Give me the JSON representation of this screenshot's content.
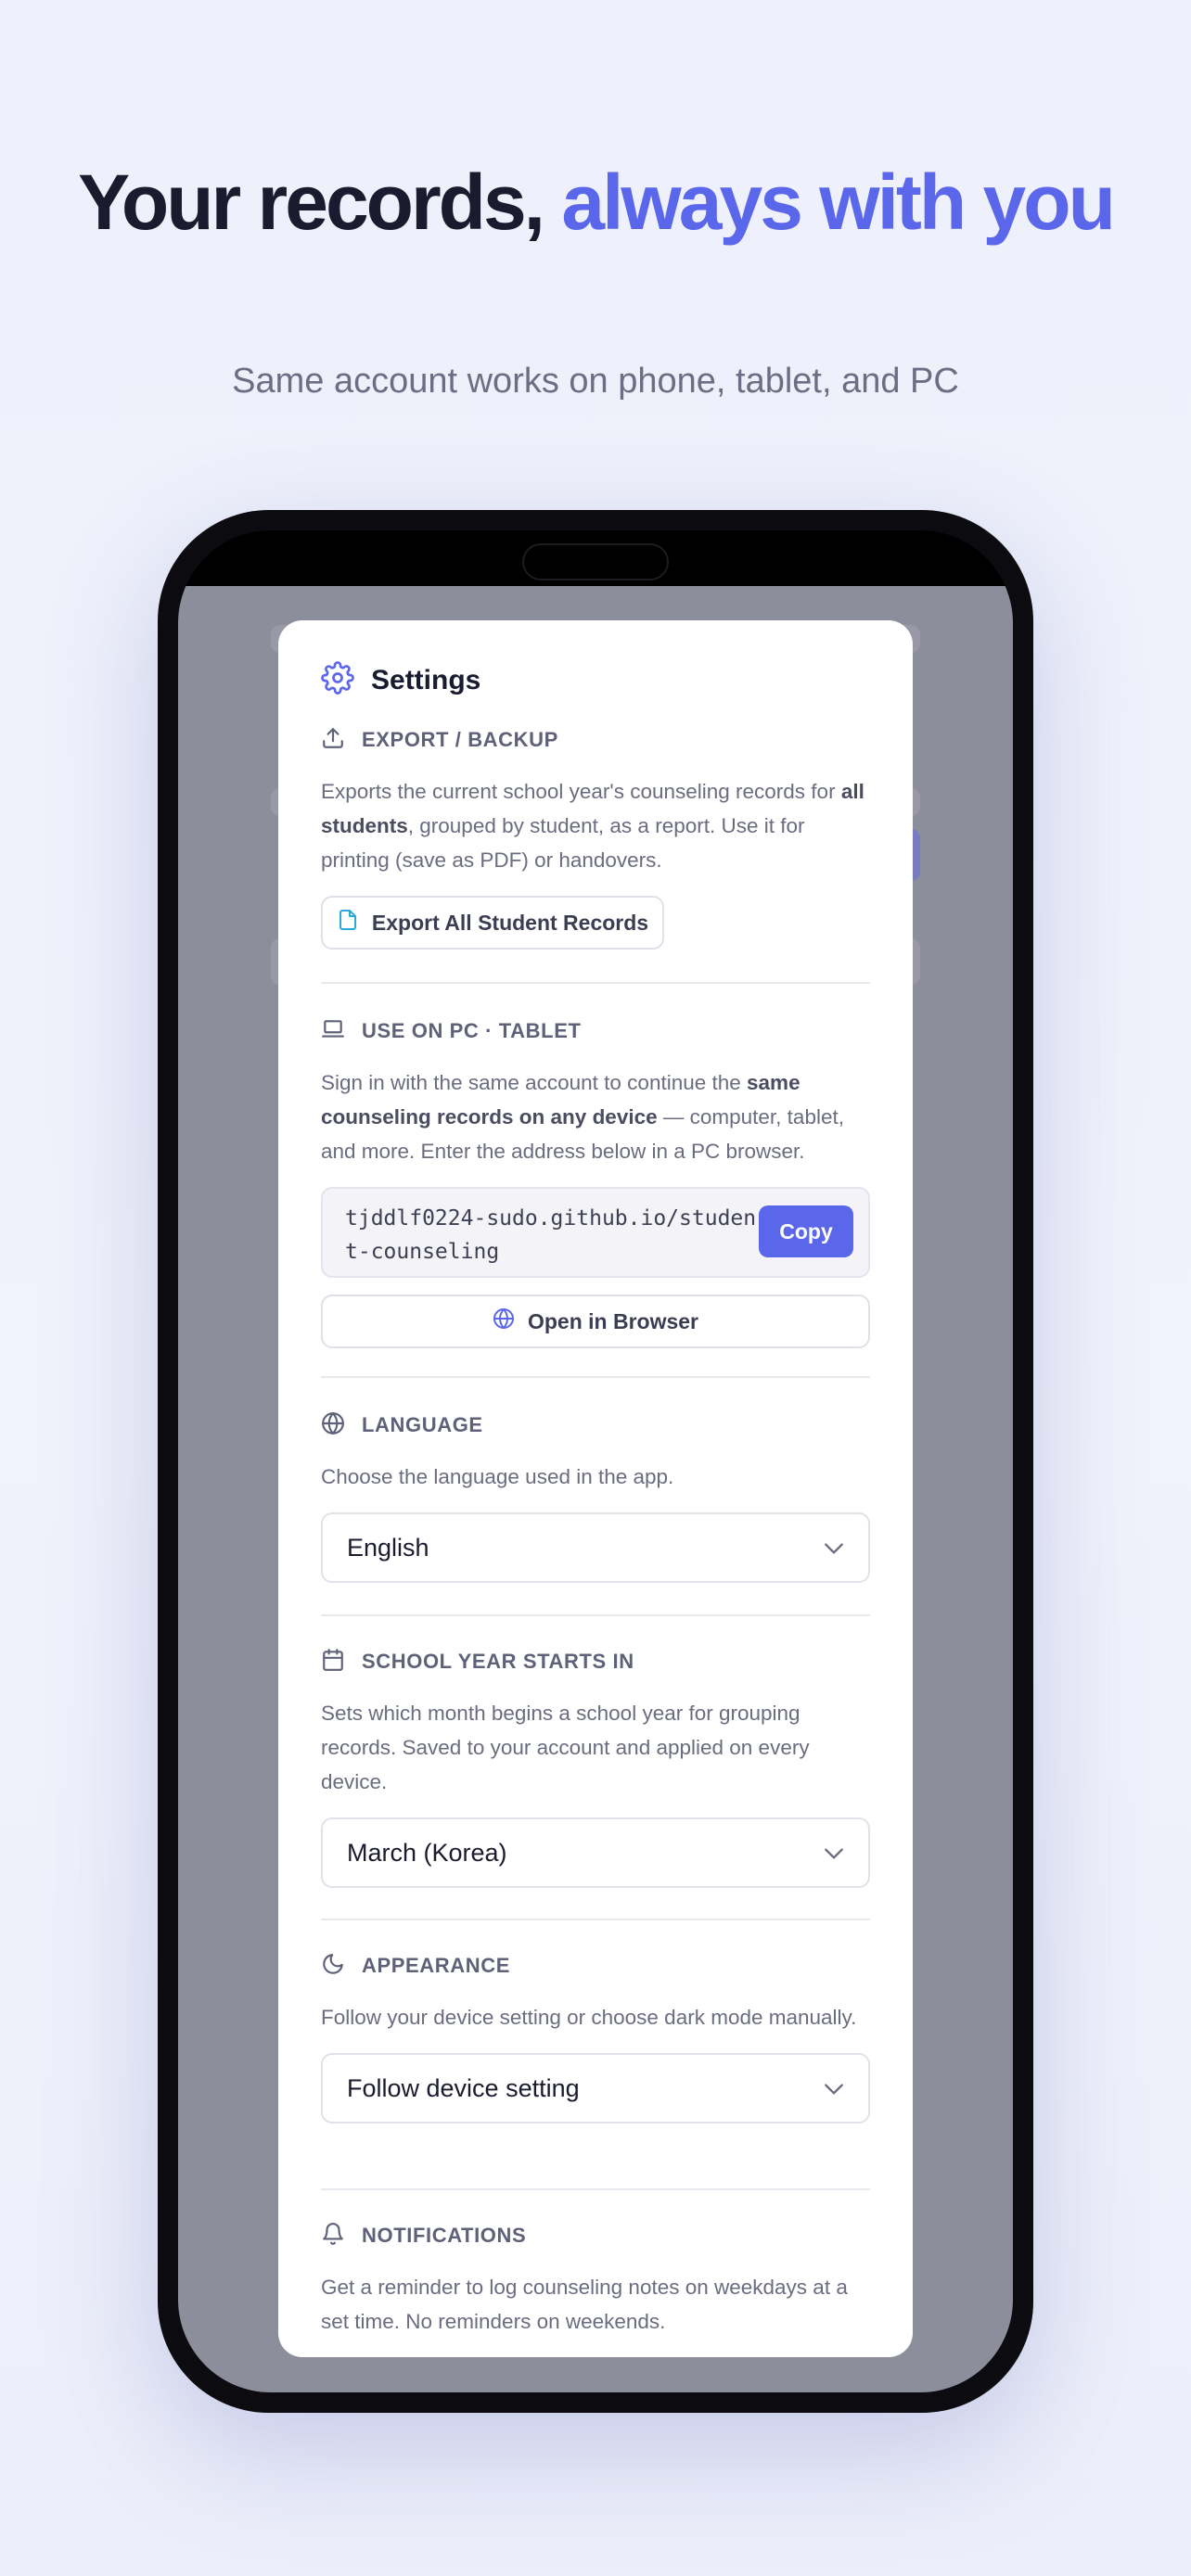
{
  "hero": {
    "title_main": "Your records, ",
    "title_accent": "always with you",
    "subtitle": "Same account works on phone, tablet, and PC"
  },
  "colors": {
    "accent": "#5b67ea",
    "background": "#eef0fb",
    "overlay": "#8d8e9c"
  },
  "settings": {
    "title": "Settings",
    "icon": "gear-icon",
    "export": {
      "icon": "upload-icon",
      "label": "EXPORT / BACKUP",
      "desc_pre": "Exports the current school year's counseling records for ",
      "desc_bold": "all students",
      "desc_post": ", grouped by student, as a report. Use it for printing (save as PDF) or handovers.",
      "button_icon": "file-icon",
      "button": "Export All Student Records"
    },
    "pc": {
      "icon": "laptop-icon",
      "label": "USE ON PC · TABLET",
      "desc_pre": "Sign in with the same account to continue the ",
      "desc_bold": "same counseling records on any device",
      "desc_post": " — computer, tablet, and more. Enter the address below in a PC browser.",
      "url": "tjddlf0224-sudo.github.io/student-counseling",
      "copy": "Copy",
      "open_icon": "globe-icon",
      "open": "Open in Browser"
    },
    "language": {
      "icon": "globe-icon",
      "label": "LANGUAGE",
      "desc": "Choose the language used in the app.",
      "selected": "English"
    },
    "school_year": {
      "icon": "calendar-icon",
      "label": "SCHOOL YEAR STARTS IN",
      "desc": "Sets which month begins a school year for grouping records. Saved to your account and applied on every device.",
      "selected": "March (Korea)"
    },
    "appearance": {
      "icon": "moon-icon",
      "label": "APPEARANCE",
      "desc": "Follow your device setting or choose dark mode manually.",
      "selected": "Follow device setting"
    },
    "notifications": {
      "icon": "bell-icon",
      "label": "NOTIFICATIONS",
      "desc": "Get a reminder to log counseling notes on weekdays at a set time. No reminders on weekends."
    }
  }
}
